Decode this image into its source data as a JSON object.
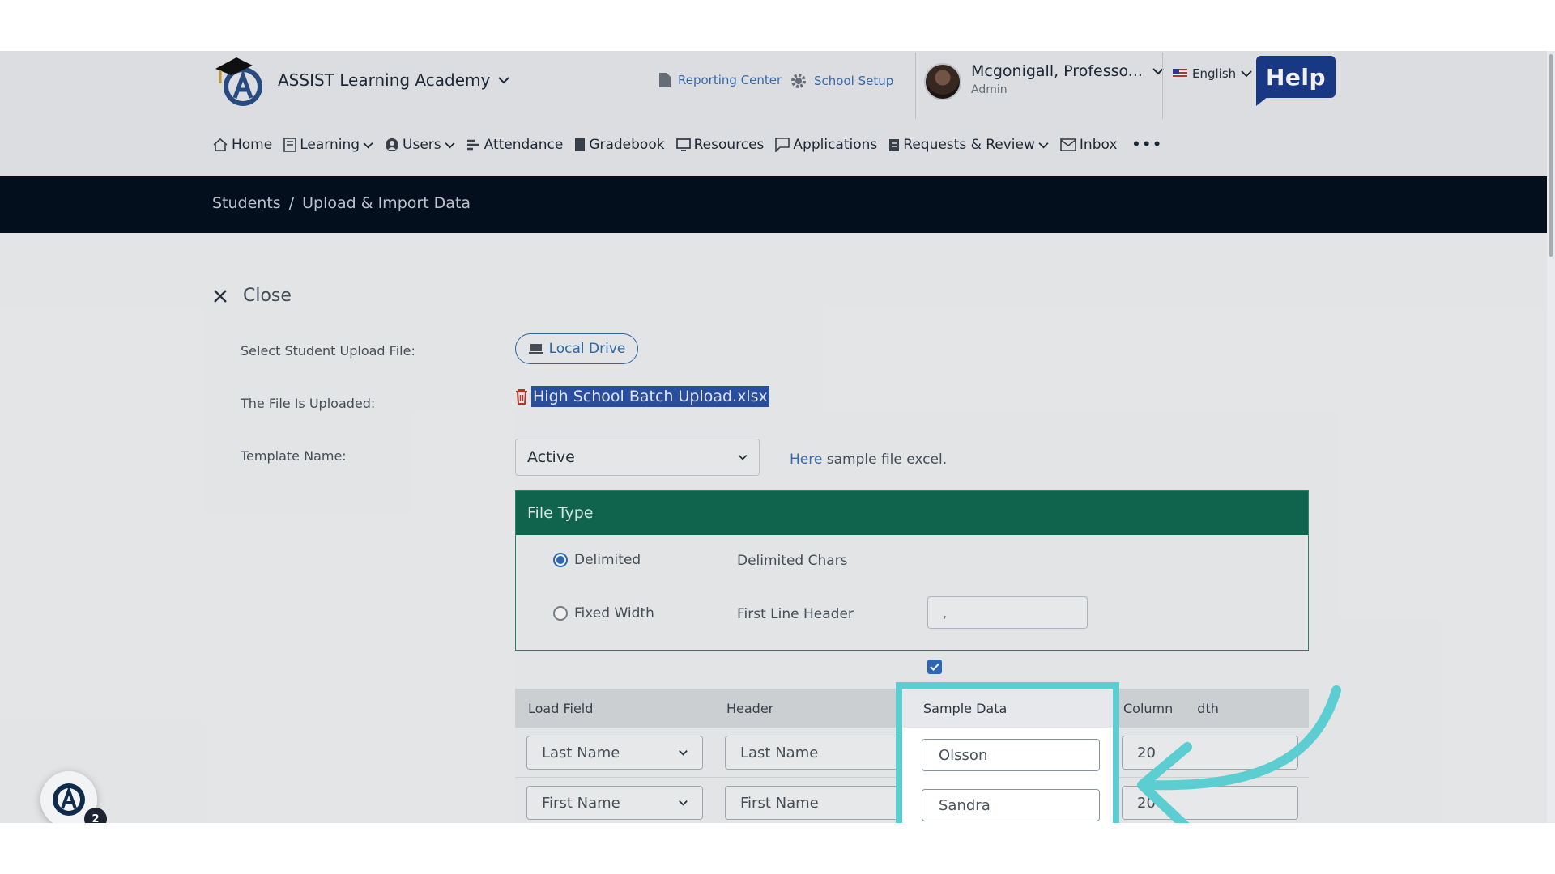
{
  "header": {
    "school_name": "ASSIST Learning Academy",
    "reporting_center": "Reporting Center",
    "school_setup": "School Setup",
    "user_name": "Mcgonigall, Professo...",
    "user_role": "Admin",
    "language": "English",
    "help_label": "Help"
  },
  "nav": {
    "items": [
      "Home",
      "Learning",
      "Users",
      "Attendance",
      "Gradebook",
      "Resources",
      "Applications",
      "Requests & Review",
      "Inbox"
    ],
    "more": "•••"
  },
  "breadcrumb": {
    "parent": "Students",
    "separator": "/",
    "current": "Upload & Import Data"
  },
  "form": {
    "close_label": "Close",
    "select_file_label": "Select Student Upload File:",
    "local_drive_label": "Local Drive",
    "uploaded_label": "The File Is Uploaded:",
    "file_name": "High School Batch Upload.xlsx",
    "template_label": "Template Name:",
    "template_value": "Active",
    "sample_link": "Here",
    "sample_text": "sample file excel."
  },
  "file_type": {
    "title": "File Type",
    "delimited_label": "Delimited",
    "delimited_selected": true,
    "fixed_width_label": "Fixed Width",
    "delimited_chars_label": "Delimited Chars",
    "delimited_chars_value": ",",
    "first_line_header_label": "First Line Header",
    "first_line_header_checked": true
  },
  "grid": {
    "headers": [
      "Load Field",
      "Header",
      "Sample Data",
      "Column Width"
    ],
    "visible_column_width_header": "Column",
    "visible_column_width_header_tail": "dth",
    "rows": [
      {
        "load_field": "Last Name",
        "header": "Last Name",
        "sample": "Olsson",
        "width": "20"
      },
      {
        "load_field": "First Name",
        "header": "First Name",
        "sample": "Sandra",
        "width": "20"
      }
    ]
  },
  "widget": {
    "badge_count": "2"
  },
  "colors": {
    "panel_header": "#126a52",
    "highlight": "#5ccdd0",
    "crumb_bar": "#04101f",
    "help_button": "#1b3c8c"
  }
}
